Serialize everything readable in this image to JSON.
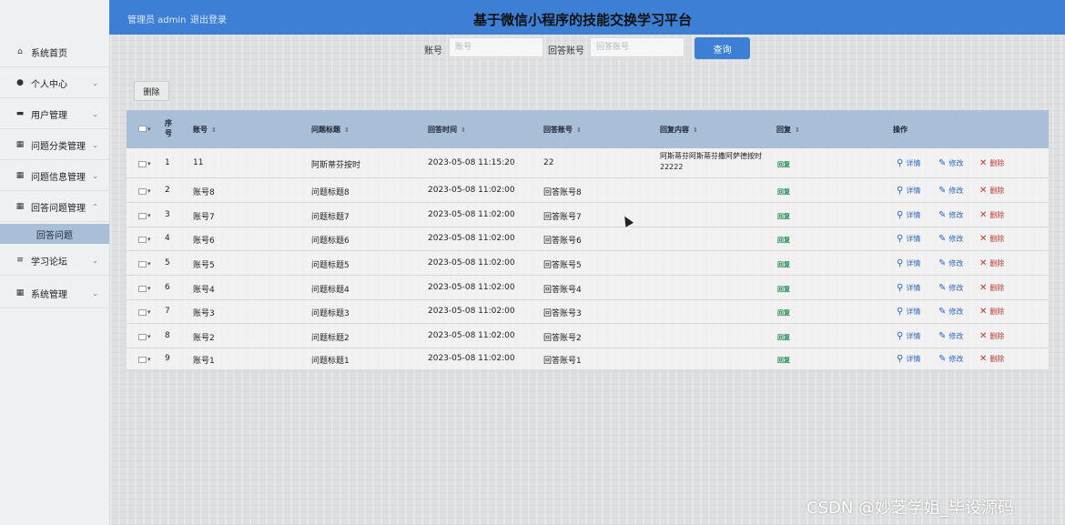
{
  "header": {
    "user_text": "管理员 admin",
    "logout": "退出登录",
    "title": "基于微信小程序的技能交换学习平台"
  },
  "sidebar": {
    "items": [
      {
        "label": "系统首页",
        "icon": "home-icon",
        "has_chevron": false
      },
      {
        "label": "个人中心",
        "icon": "user-icon",
        "chevron": "⌄"
      },
      {
        "label": "用户管理",
        "icon": "card-icon",
        "chevron": "⌄"
      },
      {
        "label": "问题分类管理",
        "icon": "grid-icon",
        "chevron": "⌄"
      },
      {
        "label": "问题信息管理",
        "icon": "grid-icon",
        "chevron": "⌄"
      },
      {
        "label": "回答问题管理",
        "icon": "grid-icon",
        "chevron": "⌃"
      },
      {
        "label": "学习论坛",
        "icon": "sliders-icon",
        "chevron": "⌄"
      },
      {
        "label": "系统管理",
        "icon": "grid-icon",
        "chevron": "⌄"
      }
    ],
    "sub_item": "回答问题"
  },
  "search": {
    "account_label": "账号",
    "account_placeholder": "账号",
    "answer_account_label": "回答账号",
    "answer_account_placeholder": "回答账号",
    "query_button": "查询"
  },
  "toolbar": {
    "delete_button": "删除"
  },
  "table": {
    "headers": [
      "序号",
      "账号",
      "问题标题",
      "回答时间",
      "回答账号",
      "回复内容",
      "回复",
      "操作"
    ],
    "rows": [
      {
        "idx": "1",
        "account": "11",
        "title": "阿斯蒂芬按时",
        "time": "2023-05-08 11:15:20",
        "answer_account": "22",
        "content": "阿斯蒂芬阿斯蒂芬撒阿萨德按时22222",
        "status": "回复"
      },
      {
        "idx": "2",
        "account": "账号8",
        "title": "问题标题8",
        "time": "2023-05-08 11:02:00",
        "answer_account": "回答账号8",
        "content": "",
        "status": "回复"
      },
      {
        "idx": "3",
        "account": "账号7",
        "title": "问题标题7",
        "time": "2023-05-08 11:02:00",
        "answer_account": "回答账号7",
        "content": "",
        "status": "回复"
      },
      {
        "idx": "4",
        "account": "账号6",
        "title": "问题标题6",
        "time": "2023-05-08 11:02:00",
        "answer_account": "回答账号6",
        "content": "",
        "status": "回复"
      },
      {
        "idx": "5",
        "account": "账号5",
        "title": "问题标题5",
        "time": "2023-05-08 11:02:00",
        "answer_account": "回答账号5",
        "content": "",
        "status": "回复"
      },
      {
        "idx": "6",
        "account": "账号4",
        "title": "问题标题4",
        "time": "2023-05-08 11:02:00",
        "answer_account": "回答账号4",
        "content": "",
        "status": "回复"
      },
      {
        "idx": "7",
        "account": "账号3",
        "title": "问题标题3",
        "time": "2023-05-08 11:02:00",
        "answer_account": "回答账号3",
        "content": "",
        "status": "回复"
      },
      {
        "idx": "8",
        "account": "账号2",
        "title": "问题标题2",
        "time": "2023-05-08 11:02:00",
        "answer_account": "回答账号2",
        "content": "",
        "status": "回复"
      },
      {
        "idx": "9",
        "account": "账号1",
        "title": "问题标题1",
        "time": "2023-05-08 11:02:00",
        "answer_account": "回答账号1",
        "content": "",
        "status": "回复"
      }
    ],
    "actions": {
      "detail": "详情",
      "edit": "修改",
      "delete": "删除"
    }
  },
  "watermark": "CSDN @妙芝学姐_毕设源码",
  "colors": {
    "header": "#3c7fd4",
    "table_header": "#a9bfd8",
    "status": "#1a8a4c",
    "delete": "#c0392b"
  }
}
